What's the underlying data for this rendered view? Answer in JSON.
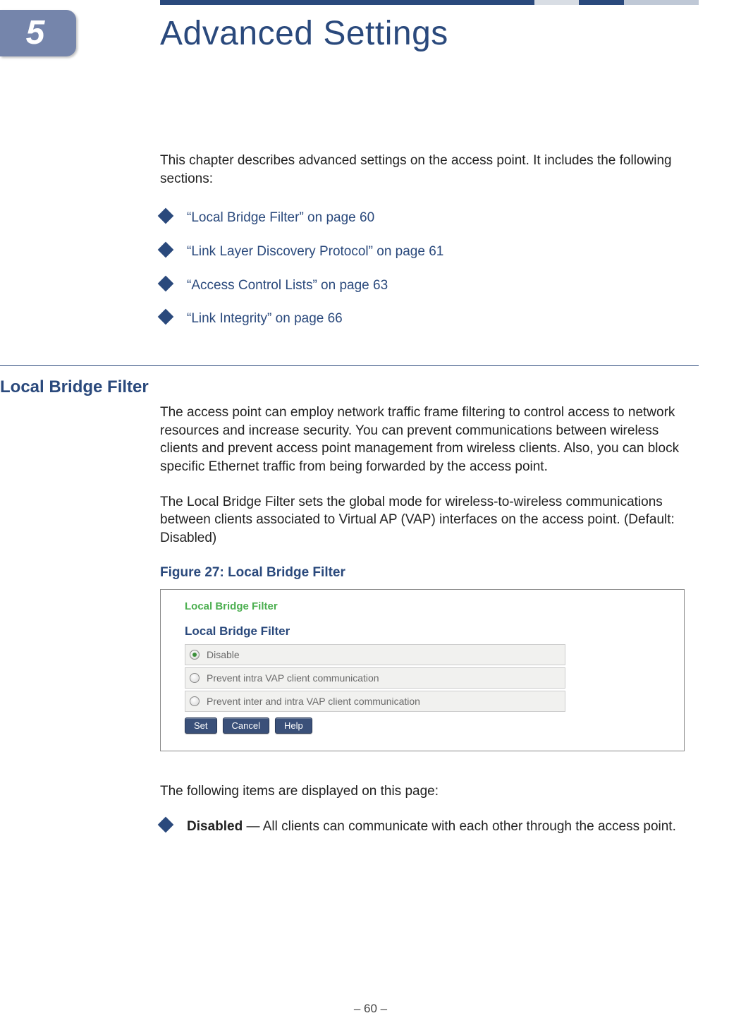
{
  "chapter": {
    "number": "5",
    "title": "Advanced Settings"
  },
  "intro": "This chapter describes advanced settings on the access point. It includes the following sections:",
  "toc": [
    "“Local Bridge Filter” on page 60",
    "“Link Layer Discovery Protocol” on page 61",
    "“Access Control Lists” on page 63",
    "“Link Integrity” on page 66"
  ],
  "section": {
    "heading": "Local Bridge Filter",
    "para1": "The access point can employ network traffic frame filtering to control access to network resources and increase security. You can prevent communications between wireless clients and prevent access point management from wireless clients. Also, you can block specific Ethernet traffic from being forwarded by the access point.",
    "para2": "The Local Bridge Filter sets the global mode for wireless-to-wireless communications between clients associated to Virtual AP (VAP) interfaces on the access point. (Default: Disabled)"
  },
  "figure": {
    "caption": "Figure 27:  Local Bridge Filter",
    "small_title": "Local Bridge Filter",
    "panel_title": "Local Bridge Filter",
    "options": [
      {
        "label": "Disable",
        "selected": true
      },
      {
        "label": "Prevent intra VAP client communication",
        "selected": false
      },
      {
        "label": "Prevent inter and intra VAP client communication",
        "selected": false
      }
    ],
    "buttons": {
      "set": "Set",
      "cancel": "Cancel",
      "help": "Help"
    }
  },
  "items_intro": "The following items are displayed on this page:",
  "items": [
    {
      "bold": "Disabled",
      "rest": " — All clients can communicate with each other through the access point."
    }
  ],
  "page_number": "–  60  –"
}
